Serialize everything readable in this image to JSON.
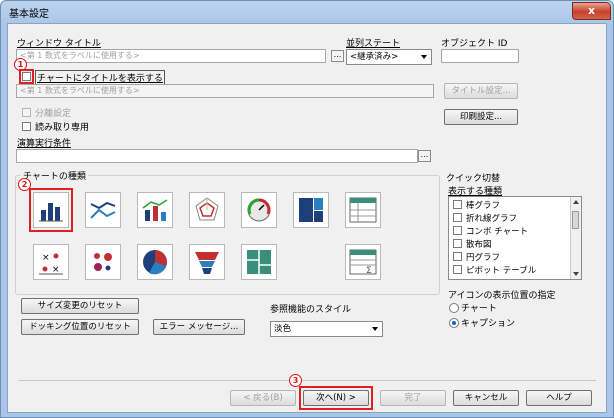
{
  "window": {
    "title": "基本設定",
    "close": "x"
  },
  "window_title": {
    "label": "ウィンドウ タイトル",
    "placeholder": "<第 1 数式をラベルに使用する>",
    "more": "..."
  },
  "state": {
    "label": "並列ステート",
    "value": "<継承済み>"
  },
  "object_id": {
    "label": "オブジェクト ID",
    "value": ""
  },
  "chart_title": {
    "checkbox_label": "チャートにタイトルを表示する",
    "placeholder": "<第 1 数式をラベルに使用する>",
    "settings_button": "タイトル設定..."
  },
  "options": {
    "detached": "分離設定",
    "readonly": "読み取り専用",
    "print_button": "印刷設定..."
  },
  "calc_condition": {
    "label": "演算実行条件",
    "value": "",
    "more": "..."
  },
  "chart_types": {
    "label": "チャートの種類",
    "items": [
      {
        "name": "bar-chart-icon"
      },
      {
        "name": "line-chart-icon"
      },
      {
        "name": "combo-chart-icon"
      },
      {
        "name": "radar-chart-icon"
      },
      {
        "name": "gauge-chart-icon"
      },
      {
        "name": "block-chart-icon"
      },
      {
        "name": "pivot-table-icon"
      },
      {
        "name": "scatter-chart-icon"
      },
      {
        "name": "grid-chart-icon"
      },
      {
        "name": "pie-chart-icon"
      },
      {
        "name": "funnel-chart-icon"
      },
      {
        "name": "mekko-chart-icon"
      },
      {
        "name": "straight-table-icon"
      }
    ]
  },
  "quick_change": {
    "label": "クイック切替",
    "list_label": "表示する種類",
    "items": [
      "棒グラフ",
      "折れ線グラフ",
      "コンボ チャート",
      "散布図",
      "円グラフ",
      "ピボット テーブル"
    ]
  },
  "icon_position": {
    "label": "アイコンの表示位置の指定",
    "chart": "チャート",
    "caption": "キャプション",
    "selected": "キャプション"
  },
  "buttons": {
    "reset_size": "サイズ変更のリセット",
    "reset_dock": "ドッキング位置のリセット",
    "error_msg": "エラー メッセージ...",
    "back": "< 戻る(B)",
    "next": "次へ(N) >",
    "finish": "完了",
    "cancel": "キャンセル",
    "help": "ヘルプ"
  },
  "ref_style": {
    "label": "参照機能のスタイル",
    "value": "淡色"
  },
  "annotations": {
    "one": "1",
    "two": "2",
    "three": "3"
  },
  "colors": {
    "highlight": "#e02020",
    "accent": "#1c5fb8"
  }
}
